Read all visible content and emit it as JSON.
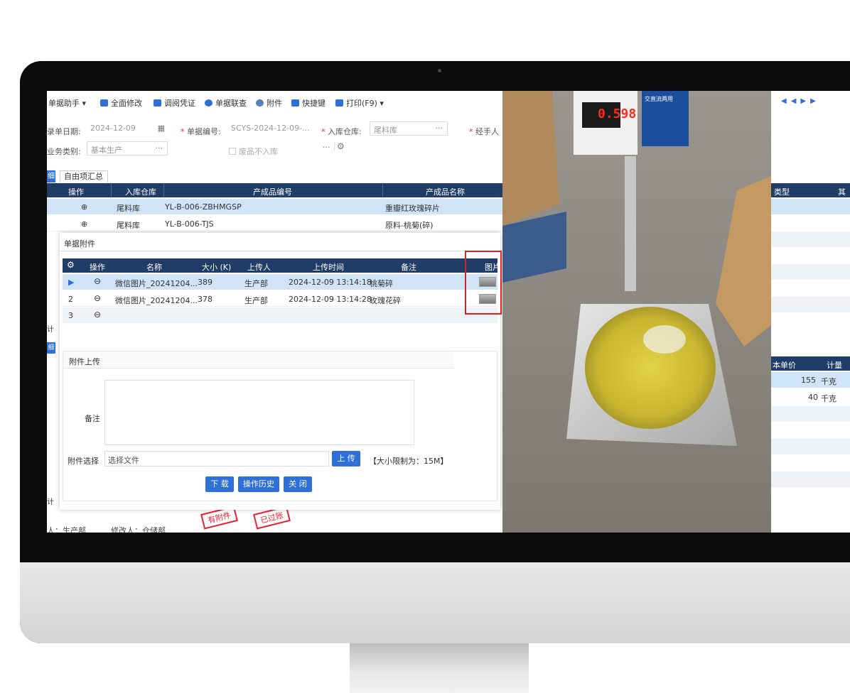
{
  "toolbar": {
    "items": [
      "单据助手 ▾",
      "全面修改",
      "调阅凭证",
      "单据联查",
      "附件",
      "快捷键",
      "打印(F9) ▾"
    ]
  },
  "form": {
    "date_label": "录单日期:",
    "date_value": "2024-12-09",
    "doc_no_label": "单据编号:",
    "doc_no_value": "SCYS-2024-12-09-...",
    "warehouse_label": "入库仓库:",
    "warehouse_value": "尾料库",
    "handler_label": "经手人",
    "biz_type_label": "业务类别:",
    "biz_type_value": "基本生产",
    "waste_checkbox": "废品不入库",
    "ellipsis": "···",
    "req_mark": "*"
  },
  "tabs": {
    "left_fragment": "细",
    "custom_summary": "自由项汇总"
  },
  "main_grid": {
    "columns": [
      "操作",
      "入库仓库",
      "产成品编号",
      "产成品名称"
    ],
    "rows": [
      {
        "op": "⊕",
        "warehouse": "尾料库",
        "code": "YL-B-006-ZBHMGSP",
        "name": "重瓣红玫瑰碎片"
      },
      {
        "op": "⊕",
        "warehouse": "尾料库",
        "code": "YL-B-006-TJS",
        "name": "原料-桃菊(碎)"
      }
    ]
  },
  "right_grid": {
    "col_type": "类型",
    "col_fragment": "其",
    "col_unit_price": "本单价",
    "col_unit": "计量",
    "rows": [
      {
        "price": "155",
        "unit": "千克"
      },
      {
        "price": "40",
        "unit": "千克"
      }
    ]
  },
  "nav": [
    "◀",
    "◀",
    "▶",
    "▶"
  ],
  "left_edge": {
    "sum1": "计",
    "detail": "细",
    "sum2": "计"
  },
  "dialog": {
    "title": "单据附件",
    "columns": [
      "操作",
      "名称",
      "大小 (K)",
      "上传人",
      "上传时间",
      "备注",
      "图片"
    ],
    "rows": [
      {
        "idx": "▶",
        "op": "⊖",
        "name": "微信图片_20241204...",
        "size": "389",
        "uploader": "生产部",
        "time": "2024-12-09 13:14:18",
        "note": "桃菊碎"
      },
      {
        "idx": "2",
        "op": "⊖",
        "name": "微信图片_20241204...",
        "size": "378",
        "uploader": "生产部",
        "time": "2024-12-09 13:14:28",
        "note": "玫瑰花碎"
      },
      {
        "idx": "3",
        "op": "⊖",
        "name": "",
        "size": "",
        "uploader": "",
        "time": "",
        "note": ""
      }
    ],
    "upload_section_title": "附件上传",
    "note_label": "备注",
    "file_select_label": "附件选择",
    "file_placeholder": "选择文件",
    "upload_button": "上 传",
    "size_limit": "【大小限制为：15M】",
    "download_button": "下 载",
    "history_button": "操作历史",
    "close_button": "关 闭"
  },
  "footer": {
    "creator": "人：生产部",
    "modifier": "修改人：仓储部",
    "stamp1": "有附件",
    "stamp2": "已过账"
  },
  "scale": {
    "reading": "0.598",
    "brand": "交直流两用"
  },
  "colors": {
    "header_navy": "#1f3d66",
    "selected_row": "#cfe4f7",
    "accent_blue": "#2f6fd8",
    "highlight_red": "#e02020",
    "scale_led": "#ff2a1a"
  }
}
